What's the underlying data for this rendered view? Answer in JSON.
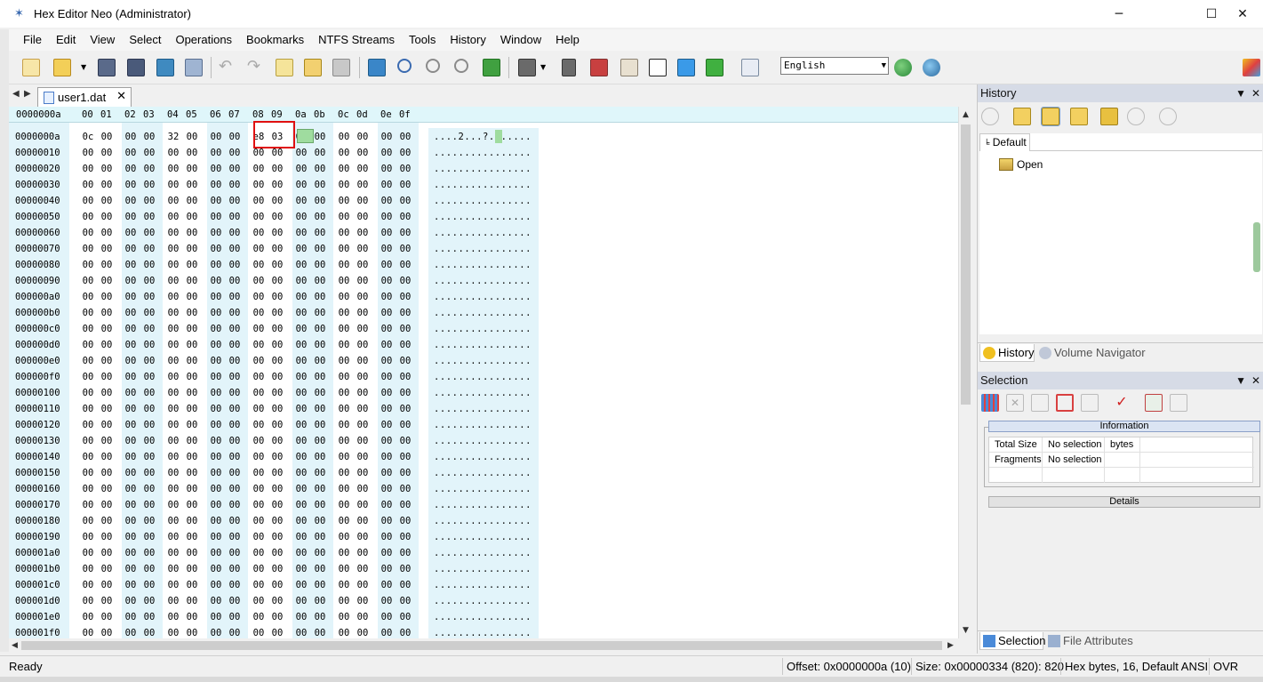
{
  "window": {
    "title": "Hex Editor Neo (Administrator)",
    "controls": {
      "minimize": "─",
      "maximize": "☐",
      "close": "✕"
    }
  },
  "menu": [
    "File",
    "Edit",
    "View",
    "Select",
    "Operations",
    "Bookmarks",
    "NTFS Streams",
    "Tools",
    "History",
    "Window",
    "Help"
  ],
  "toolbar": {
    "language": "English",
    "icons": [
      "new-file-icon",
      "open-file-icon",
      "dropdown-icon",
      "save-icon",
      "save-all-icon",
      "save-as-icon",
      "print-icon",
      "undo-icon",
      "redo-icon",
      "edit-icon",
      "paste-icon",
      "copy-icon",
      "export-icon",
      "find-icon",
      "find-next-icon",
      "find-previous-icon",
      "goto-icon",
      "bit-view-icon",
      "select-icon",
      "pattern-icon",
      "structure-icon",
      "binary-icon",
      "fullscreen-icon",
      "highlight-icon",
      "help-icon",
      "globe-icon",
      "globe-settings-icon"
    ]
  },
  "document_tab": {
    "label": "user1.dat",
    "close": "✕"
  },
  "hex": {
    "header_offset": "0000000a",
    "header_columns": [
      "00",
      "01",
      "02",
      "03",
      "04",
      "05",
      "06",
      "07",
      "08",
      "09",
      "0a",
      "0b",
      "0c",
      "0d",
      "0e",
      "0f"
    ],
    "offsets": [
      "0000000a",
      "00000010",
      "00000020",
      "00000030",
      "00000040",
      "00000050",
      "00000060",
      "00000070",
      "00000080",
      "00000090",
      "000000a0",
      "000000b0",
      "000000c0",
      "000000d0",
      "000000e0",
      "000000f0",
      "00000100",
      "00000110",
      "00000120",
      "00000130",
      "00000140",
      "00000150",
      "00000160",
      "00000170",
      "00000180",
      "00000190",
      "000001a0",
      "000001b0",
      "000001c0",
      "000001d0",
      "000001e0",
      "000001f0"
    ],
    "first_row_bytes": [
      "0c",
      "00",
      "00",
      "00",
      "32",
      "00",
      "00",
      "00",
      "e8",
      "03",
      "00",
      "00",
      "00",
      "00",
      "00",
      "00"
    ],
    "zero_byte": "00",
    "first_row_ascii": "....2...?.......",
    "ascii_zero_row": "................"
  },
  "history_panel": {
    "title": "History",
    "pin": "📌",
    "close": "✕",
    "tab": "Default",
    "entry": "Open",
    "tabs": [
      {
        "label": "History"
      },
      {
        "label": "Volume Navigator"
      }
    ]
  },
  "selection_panel": {
    "title": "Selection",
    "information_label": "Information",
    "details_label": "Details",
    "rows": [
      {
        "label": "Total Size",
        "value": "No selection",
        "unit": "bytes"
      },
      {
        "label": "Fragments",
        "value": "No selection",
        "unit": ""
      }
    ],
    "tabs": [
      {
        "label": "Selection"
      },
      {
        "label": "File Attributes"
      }
    ]
  },
  "status": {
    "ready": "Ready",
    "offset": "Offset: 0x0000000a (10)",
    "size": "Size: 0x00000334 (820): 820",
    "mode": "Hex bytes, 16, Default ANSI",
    "ovr": "OVR"
  },
  "colors": {
    "column_band": "#e2f4fa",
    "highlight_box": "#e01010",
    "cursor": "#9fdc9f",
    "panel_title": "#d6dbe6"
  }
}
